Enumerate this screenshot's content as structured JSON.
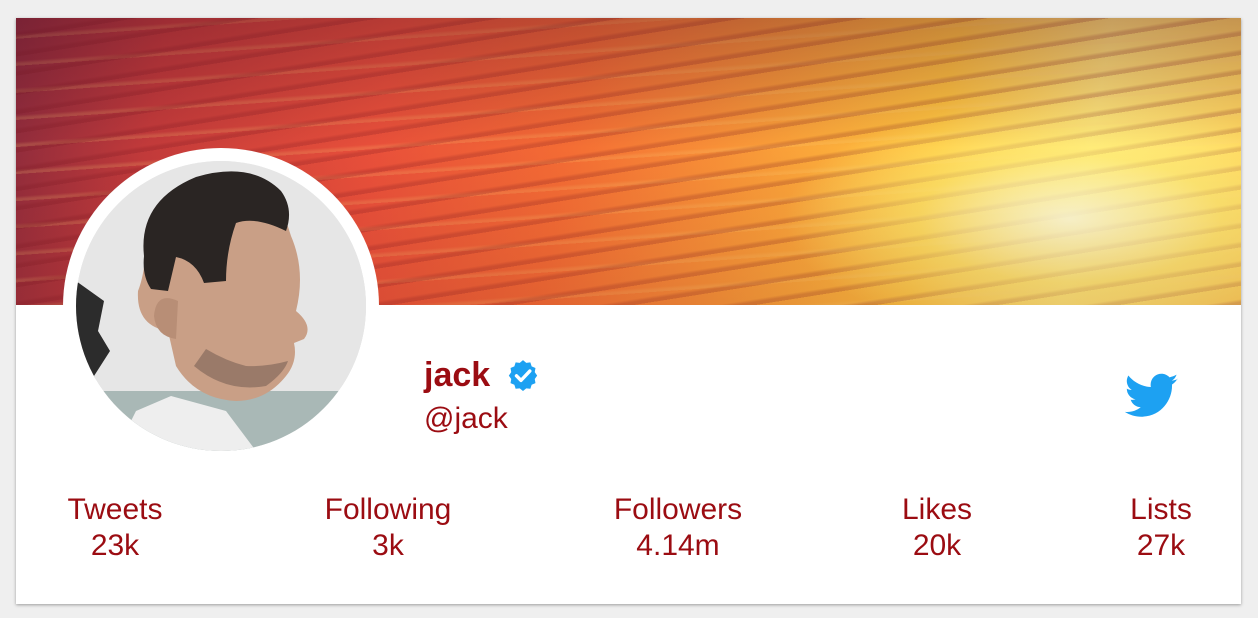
{
  "profile": {
    "name": "jack",
    "handle": "@jack",
    "verified": true,
    "accent_color": "#9b0c12",
    "verified_color": "#1da1f2"
  },
  "icons": {
    "verified": "verified-badge-icon",
    "logo": "twitter-bird-icon"
  },
  "stats": [
    {
      "label": "Tweets",
      "value": "23k"
    },
    {
      "label": "Following",
      "value": "3k"
    },
    {
      "label": "Followers",
      "value": "4.14m"
    },
    {
      "label": "Likes",
      "value": "20k"
    },
    {
      "label": "Lists",
      "value": "27k"
    }
  ]
}
